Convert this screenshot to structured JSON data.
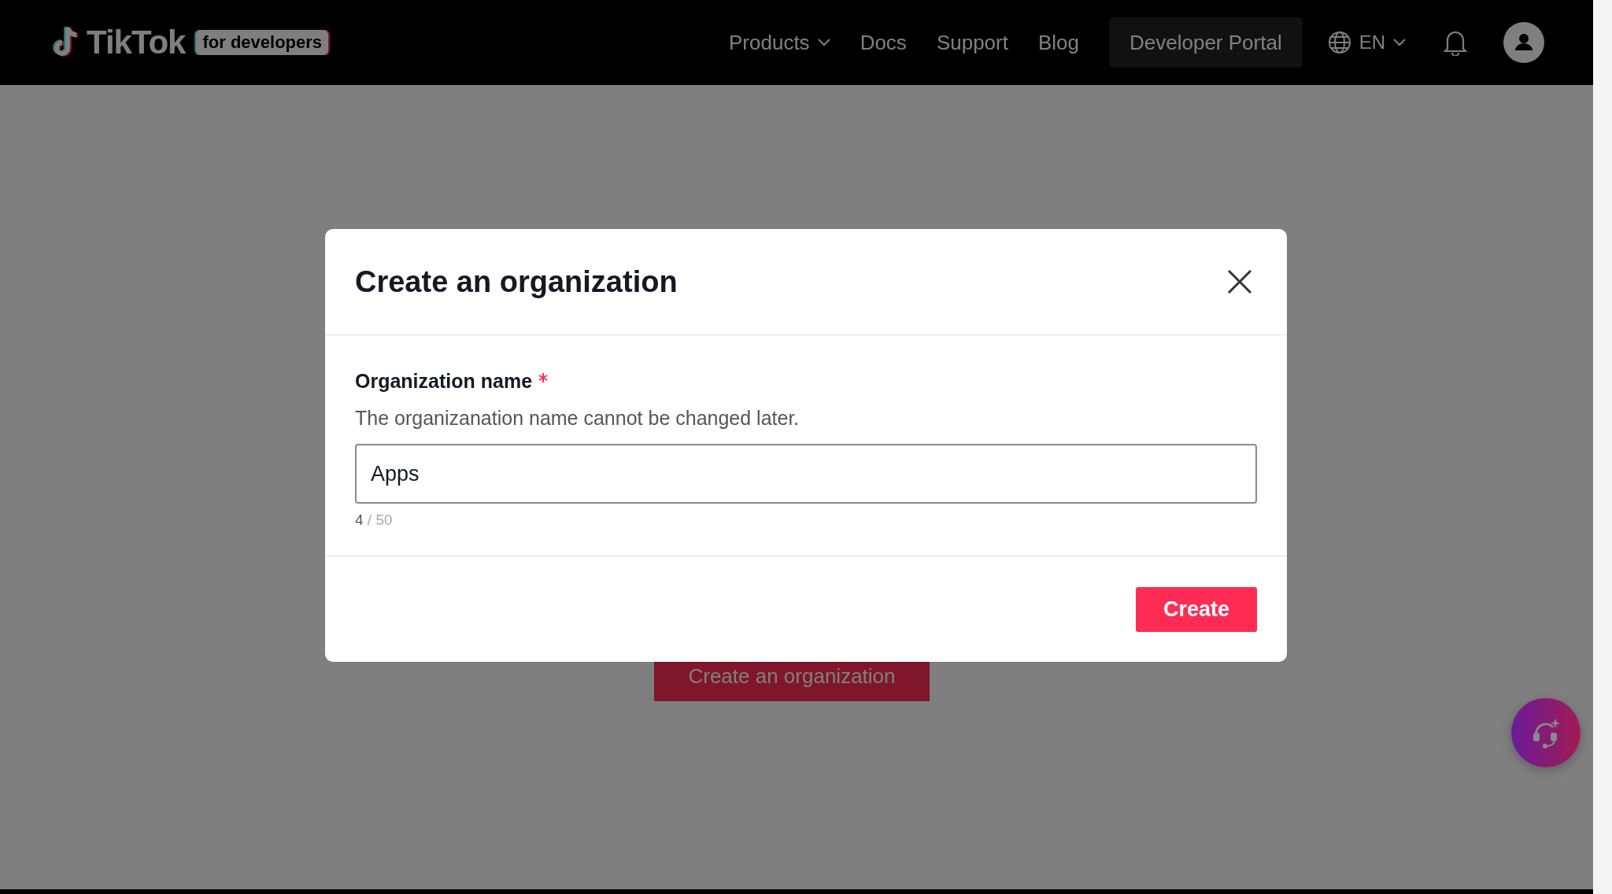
{
  "header": {
    "logo": {
      "wordmark": "TikTok",
      "badge": "for developers"
    },
    "nav": [
      {
        "label": "Products",
        "dropdown": true
      },
      {
        "label": "Docs",
        "dropdown": false
      },
      {
        "label": "Support",
        "dropdown": false
      },
      {
        "label": "Blog",
        "dropdown": false
      }
    ],
    "portal_button": "Developer Portal",
    "language": "EN"
  },
  "page": {
    "create_button": "Create an organization"
  },
  "dialog": {
    "title": "Create an organization",
    "field": {
      "label": "Organization name",
      "required": true,
      "hint": "The organizanation name cannot be changed later.",
      "value": "Apps",
      "count": "4",
      "limit": "/ 50"
    },
    "submit": "Create"
  }
}
